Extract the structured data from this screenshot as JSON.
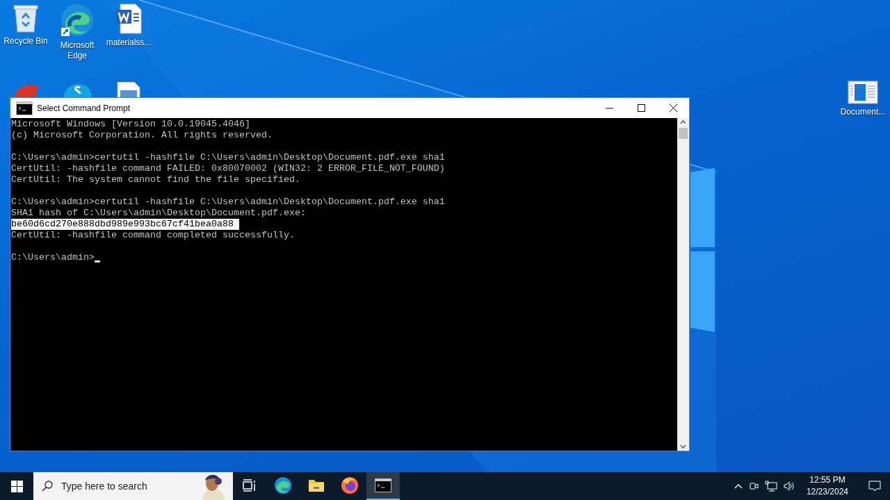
{
  "desktop_icons": [
    {
      "kind": "recycle",
      "label": "Recycle Bin"
    },
    {
      "kind": "edge",
      "label": "Microsoft Edge"
    },
    {
      "kind": "word",
      "label": "materialss..."
    }
  ],
  "desktop_icons_hidden": [
    {
      "kind": "ccleaner"
    },
    {
      "kind": "skype"
    },
    {
      "kind": "document"
    }
  ],
  "desktop_icons_right": [
    {
      "kind": "document",
      "label": "Document..."
    }
  ],
  "window": {
    "title": "Select Command Prompt",
    "lines": [
      {
        "kind": "output",
        "text": "Microsoft Windows [Version 10.0.19045.4046]",
        "selected": false
      },
      {
        "kind": "output",
        "text": "(c) Microsoft Corporation. All rights reserved.",
        "selected": false
      },
      {
        "kind": "blank"
      },
      {
        "kind": "output",
        "text": "C:\\Users\\admin>certutil -hashfile C:\\Users\\admin\\Desktop\\Document.pdf.exe sha1",
        "selected": false
      },
      {
        "kind": "output",
        "text": "CertUtil: -hashfile command FAILED: 0x80070002 (WIN32: 2 ERROR_FILE_NOT_FOUND)",
        "selected": false
      },
      {
        "kind": "output",
        "text": "CertUtil: The system cannot find the file specified.",
        "selected": false
      },
      {
        "kind": "blank"
      },
      {
        "kind": "output",
        "text": "C:\\Users\\admin>certutil -hashfile C:\\Users\\admin\\Desktop\\Document.pdf.exe sha1",
        "selected": false
      },
      {
        "kind": "output",
        "text": "SHA1 hash of C:\\Users\\admin\\Desktop\\Document.pdf.exe:",
        "selected": false
      },
      {
        "kind": "output",
        "text": "be60d6cd270e888dbd989e993bc67cf41bea0a88 ",
        "selected": true
      },
      {
        "kind": "output",
        "text": "CertUtil: -hashfile command completed successfully.",
        "selected": false
      },
      {
        "kind": "blank"
      },
      {
        "kind": "prompt",
        "text": "C:\\Users\\admin>",
        "selected": false
      }
    ]
  },
  "taskbar": {
    "search": {
      "placeholder": "Type here to search"
    },
    "apps": [
      {
        "kind": "taskview",
        "selected": false
      },
      {
        "kind": "edge",
        "selected": false
      },
      {
        "kind": "explorer",
        "selected": false
      },
      {
        "kind": "firefox",
        "selected": false
      },
      {
        "kind": "cmd",
        "selected": true
      }
    ],
    "clock": {
      "time": "12:55 PM",
      "date": "12/23/2024"
    }
  }
}
